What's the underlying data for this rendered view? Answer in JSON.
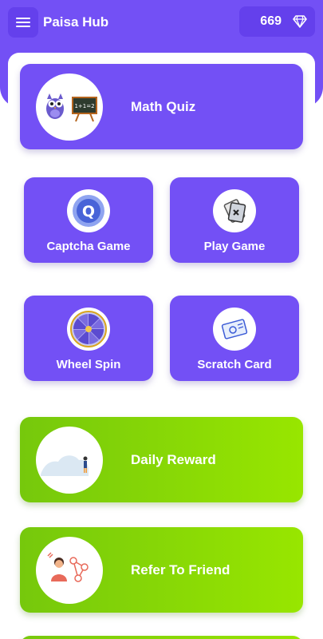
{
  "app_bar": {
    "title": "Paisa Hub",
    "coin_balance": "669",
    "menu_icon": "hamburger-menu-icon",
    "gem_icon": "diamond-icon"
  },
  "colors": {
    "primary": "#7350f5",
    "primary_dark": "#6440ec",
    "green_start": "#76c80c",
    "green_end": "#98e600"
  },
  "cards": {
    "math_quiz": {
      "label": "Math Quiz",
      "icon": "owl-blackboard-icon"
    },
    "captcha_game": {
      "label": "Captcha Game",
      "icon": "q-logo-icon"
    },
    "play_game": {
      "label": "Play Game",
      "icon": "game-card-icon"
    },
    "wheel_spin": {
      "label": "Wheel Spin",
      "icon": "spin-wheel-icon"
    },
    "scratch_card": {
      "label": "Scratch Card",
      "icon": "ticket-icon"
    },
    "daily_reward": {
      "label": "Daily Reward",
      "icon": "person-landscape-icon"
    },
    "refer_friend": {
      "label": "Refer To Friend",
      "icon": "referral-network-icon"
    }
  }
}
